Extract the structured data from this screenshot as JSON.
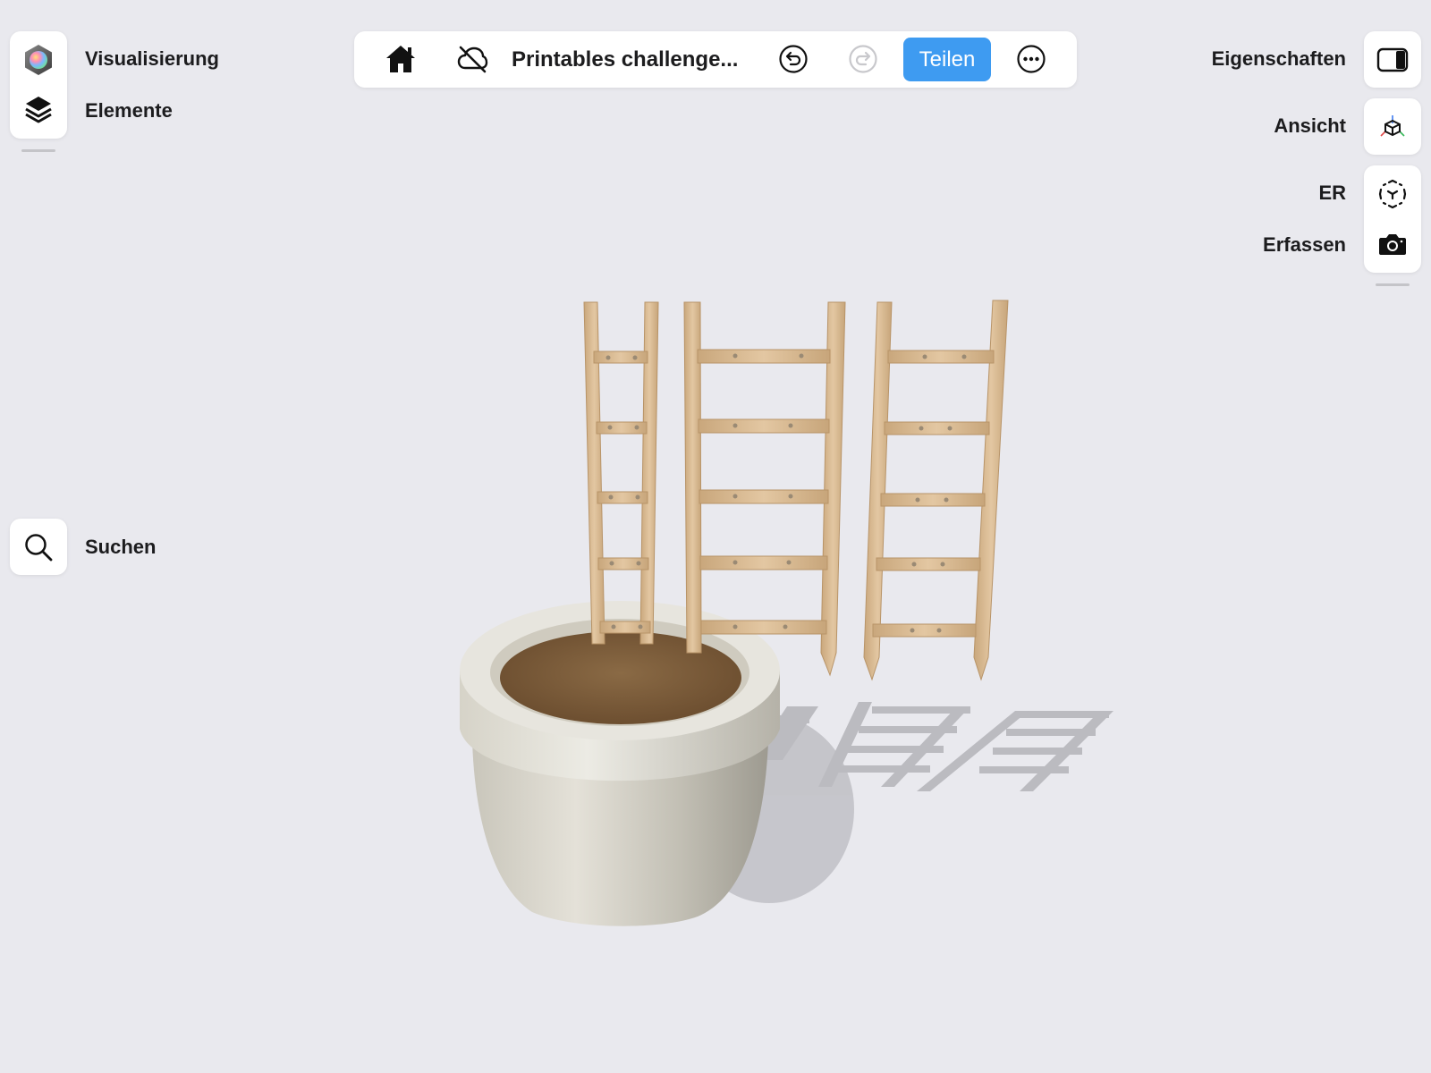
{
  "toolbar": {
    "title": "Printables challenge...",
    "share_label": "Teilen",
    "icons": [
      "home-icon",
      "cloud-off-icon",
      "undo-icon",
      "redo-icon",
      "more-icon"
    ]
  },
  "left_panel": {
    "items": [
      {
        "label": "Visualisierung",
        "icon": "color-sphere-icon"
      },
      {
        "label": "Elemente",
        "icon": "layers-icon"
      }
    ]
  },
  "search": {
    "label": "Suchen",
    "icon": "search-icon"
  },
  "right_panel": {
    "properties": {
      "label": "Eigenschaften",
      "icon": "sidebar-toggle-icon"
    },
    "view": {
      "label": "Ansicht",
      "icon": "view-cube-icon"
    },
    "ar": {
      "label": "ER",
      "icon": "ar-icon"
    },
    "capture": {
      "label": "Erfassen",
      "icon": "camera-icon"
    }
  },
  "colors": {
    "background": "#e9e9ee",
    "accent": "#3e9bf1",
    "wood": "#dcbc94",
    "pot": "#d9d6cc",
    "soil": "#7a5a38"
  }
}
